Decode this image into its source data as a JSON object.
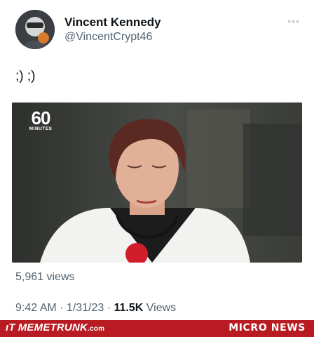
{
  "author": {
    "name": "Vincent Kennedy",
    "handle": "@VincentCrypt46",
    "more_icon": "ellipsis-icon"
  },
  "tweet": {
    "text": ";) ;)",
    "media": {
      "logo_number": "60",
      "logo_label": "MINUTES"
    }
  },
  "stats": {
    "views_label": "5,961 views",
    "timestamp": "9:42 AM · 1/31/23 · ",
    "view_count": "11.5K",
    "view_count_suffix": " Views"
  },
  "footer": {
    "site": "MEMETRUNK",
    "site_suffix": ".com",
    "section": "MICRO NEWS",
    "brand_color": "#b81c22"
  }
}
